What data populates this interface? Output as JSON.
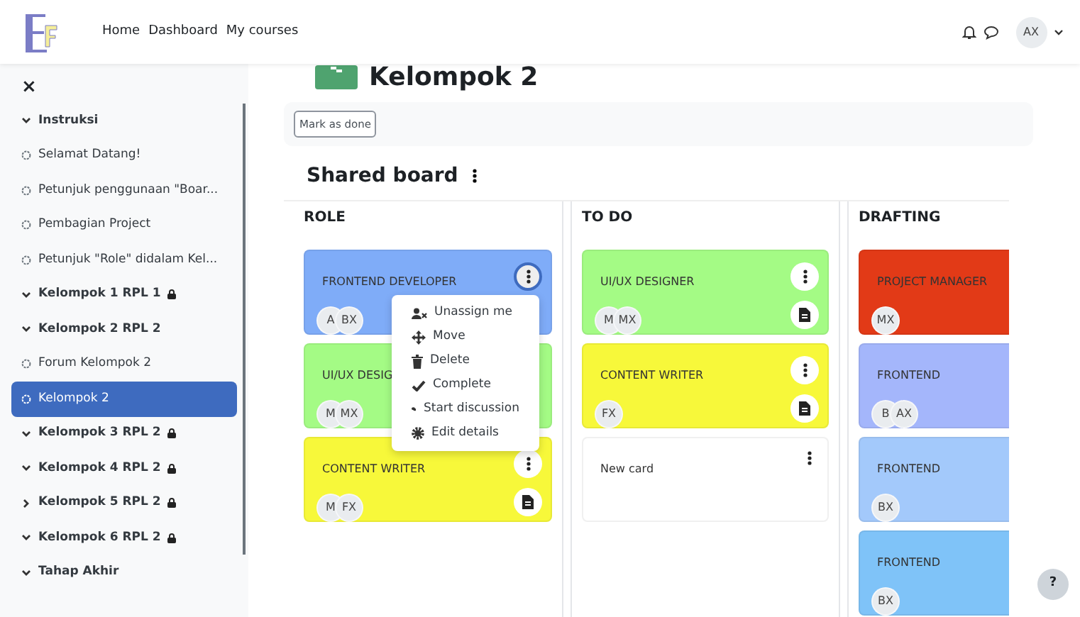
{
  "navbar": {
    "links": [
      "Home",
      "Dashboard",
      "My courses"
    ],
    "user_initials": "AX"
  },
  "sidebar": {
    "close": "×",
    "items": [
      {
        "kind": "section",
        "label": "Instruksi",
        "expanded": true,
        "selected": false,
        "children": [
          {
            "kind": "activity",
            "label": "Selamat Datang!",
            "selected": false
          },
          {
            "kind": "activity",
            "label": "Petunjuk penggunaan \"Boar...",
            "selected": false
          },
          {
            "kind": "activity",
            "label": "Pembagian Project",
            "selected": false
          },
          {
            "kind": "activity",
            "label": "Petunjuk \"Role\" didalam Kel...",
            "selected": false
          }
        ]
      },
      {
        "kind": "section",
        "label": "Kelompok 1 RPL 1",
        "expanded": true,
        "locked": true,
        "selected": false
      },
      {
        "kind": "section",
        "label": "Kelompok 2 RPL 2",
        "expanded": true,
        "selected": false,
        "children": [
          {
            "kind": "activity",
            "label": "Forum Kelompok 2",
            "selected": false
          },
          {
            "kind": "activity",
            "label": "Kelompok 2",
            "selected": true
          }
        ]
      },
      {
        "kind": "section",
        "label": "Kelompok 3 RPL 2",
        "expanded": true,
        "locked": true,
        "selected": false
      },
      {
        "kind": "section",
        "label": "Kelompok 4 RPL 2",
        "expanded": true,
        "locked": true,
        "selected": false
      },
      {
        "kind": "section",
        "label": "Kelompok 5 RPL 2",
        "expanded": false,
        "locked": true,
        "selected": false
      },
      {
        "kind": "section",
        "label": "Kelompok 6 RPL 2",
        "expanded": true,
        "locked": true,
        "selected": false
      },
      {
        "kind": "section",
        "label": "Tahap Akhir",
        "expanded": true,
        "selected": false
      }
    ]
  },
  "page": {
    "title": "Kelompok 2",
    "mark_button": "Mark as done",
    "board_title": "Shared board"
  },
  "columns": [
    {
      "title": "ROLE",
      "cards": [
        {
          "title": "FRONTEND DEVELOPER",
          "color": "#7facf8",
          "people": [
            "A",
            "BX"
          ],
          "menu_button": true,
          "menu_open": true
        },
        {
          "title": "UI/UX DESIG",
          "color": "#a4fb85",
          "people": [
            "M",
            "MX"
          ]
        },
        {
          "title": "CONTENT WRITER",
          "color": "#f7f83a",
          "people": [
            "M",
            "FX"
          ],
          "menu_button": true,
          "note_button": true
        }
      ]
    },
    {
      "title": "TO DO",
      "cards": [
        {
          "title": "UI/UX DESIGNER",
          "color": "#a4fb85",
          "people": [
            "M",
            "MX"
          ],
          "menu_button": true,
          "note_button": true
        },
        {
          "title": "CONTENT WRITER",
          "color": "#f7f83a",
          "people": [
            "FX"
          ],
          "menu_button": true,
          "note_button": true
        },
        {
          "title": "New card",
          "color": "#ffffff",
          "kind": "blank",
          "menu_button": true
        }
      ]
    },
    {
      "title": "DRAFTING",
      "cards": [
        {
          "title": "PROJECT MANAGER",
          "color": "#e23a17",
          "people": [
            "MX"
          ]
        },
        {
          "title": "FRONTEND",
          "color": "#a4b6fb",
          "people": [
            "B",
            "AX"
          ]
        },
        {
          "title": "FRONTEND",
          "color": "#a3c9fb",
          "people": [
            "BX"
          ]
        },
        {
          "title": "FRONTEND",
          "color": "#7fc3f8",
          "people": [
            "BX"
          ]
        }
      ]
    }
  ],
  "card_menu": {
    "items": [
      "Unassign me",
      "Move",
      "Delete",
      "Complete",
      "Start discussion",
      "Edit details"
    ]
  },
  "help_button": "?"
}
